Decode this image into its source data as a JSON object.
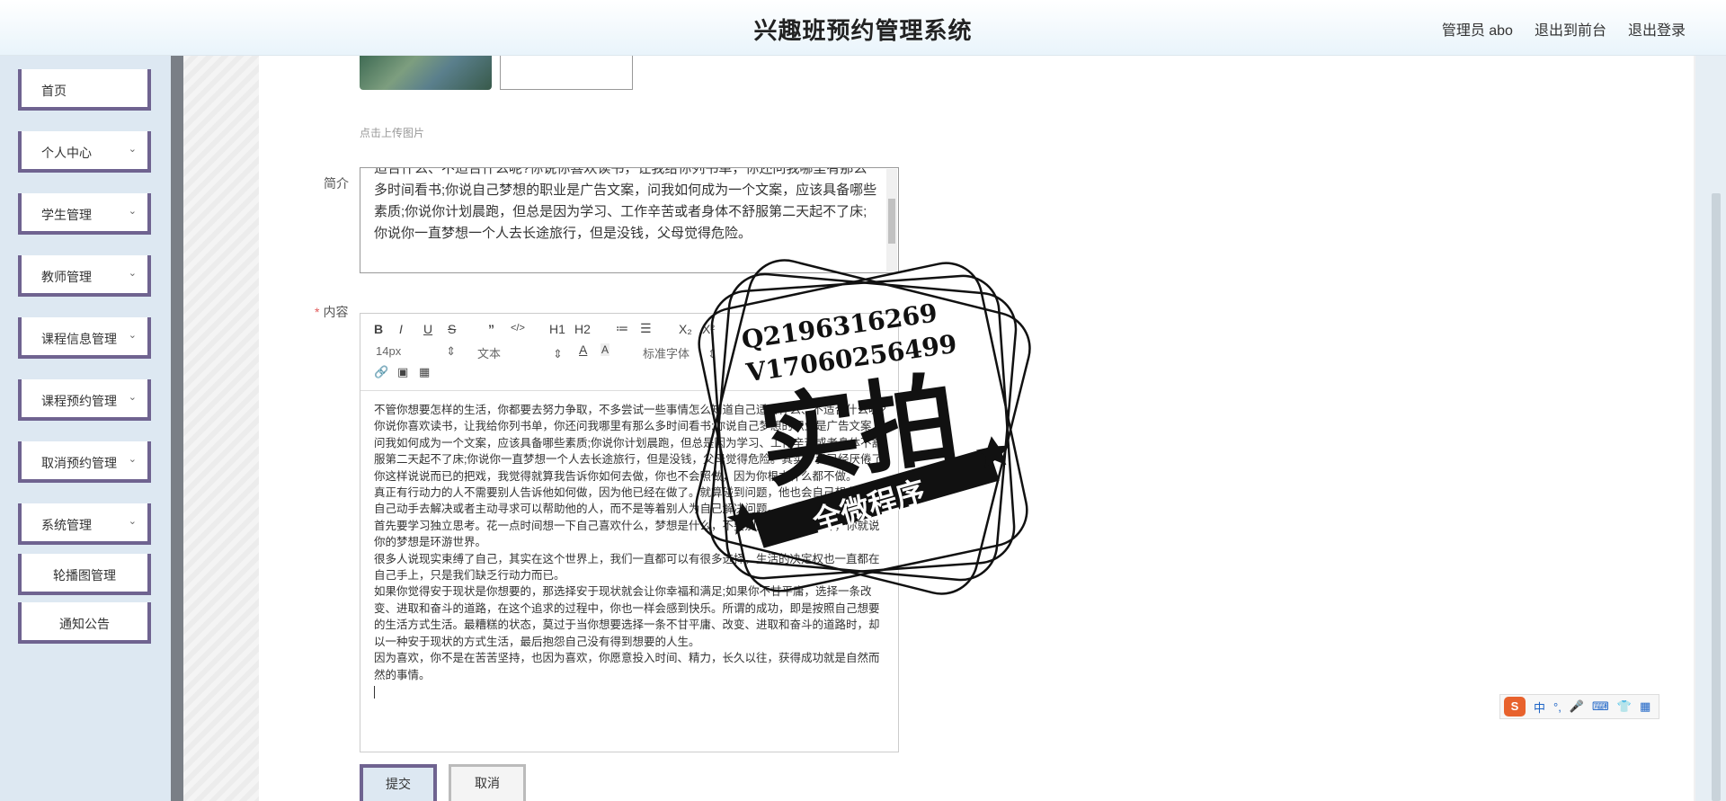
{
  "header": {
    "title": "兴趣班预约管理系统",
    "admin_label": "管理员 abo",
    "front_label": "退出到前台",
    "logout_label": "退出登录"
  },
  "sidebar": {
    "items": [
      {
        "label": "首页",
        "has_arrow": false
      },
      {
        "label": "个人中心",
        "has_arrow": true
      },
      {
        "label": "学生管理",
        "has_arrow": true
      },
      {
        "label": "教师管理",
        "has_arrow": true
      },
      {
        "label": "课程信息管理",
        "has_arrow": true
      },
      {
        "label": "课程预约管理",
        "has_arrow": true
      },
      {
        "label": "取消预约管理",
        "has_arrow": true
      },
      {
        "label": "系统管理",
        "has_arrow": true
      },
      {
        "label": "轮播图管理",
        "has_arrow": false
      },
      {
        "label": "通知公告",
        "has_arrow": false
      }
    ]
  },
  "form": {
    "upload_tip": "点击上传图片",
    "intro_label": "简介",
    "intro_text": "适合什么、不适合什么呢?你说你喜欢读书，让我给你列书单，你还问我哪里有那么多时间看书;你说自己梦想的职业是广告文案，问我如何成为一个文案，应该具备哪些素质;你说你计划晨跑，但总是因为学习、工作辛苦或者身体不舒服第二天起不了床;你说你一直梦想一个人去长途旅行，但是没钱，父母觉得危险。",
    "content_required_mark": "*",
    "content_label": "内容",
    "submit_label": "提交",
    "cancel_label": "取消"
  },
  "editor": {
    "toolbar": {
      "bold": "B",
      "italic": "I",
      "underline": "U",
      "strike": "S",
      "quote": "”",
      "code": "</>",
      "h1": "H1",
      "h2": "H2",
      "ordered_list": "≔",
      "bullet_list": "☰",
      "subscript": "X₂",
      "superscript": "X²",
      "font_size": "14px",
      "text_style": "文本",
      "font_family": "标准字体"
    },
    "paragraphs": [
      "不管你想要怎样的生活，你都要去努力争取，不多尝试一些事情怎么知道自己适合什么、不适合什么呢?",
      "你说你喜欢读书，让我给你列书单，你还问我哪里有那么多时间看书;你说自己梦想的职业是广告文案，问我如何成为一个文案，应该具备哪些素质;你说你计划晨跑，但总是因为学习、工作辛苦或者身体不舒服第二天起不了床;你说你一直梦想一个人去长途旅行，但是没钱，父母觉得危险。其实，我已经厌倦了你这样说说而已的把戏，我觉得就算我告诉你如何去做，你也不会照做，因为你根本什么都不做。",
      "真正有行动力的人不需要别人告诉他如何做，因为他已经在做了。就算碰到问题，他也会自己想办法，自己动手去解决或者主动寻求可以帮助他的人，而不是等着别人为自己解决问题。",
      "首先要学习独立思考。花一点时间想一下自己喜欢什么，梦想是什么，不要别人说想环游世界，你就说你的梦想是环游世界。",
      "很多人说现实束缚了自己，其实在这个世界上，我们一直都可以有很多选择，生活的决定权也一直都在自己手上，只是我们缺乏行动力而已。",
      "如果你觉得安于现状是你想要的，那选择安于现状就会让你幸福和满足;如果你不甘平庸，选择一条改变、进取和奋斗的道路，在这个追求的过程中，你也一样会感到快乐。所谓的成功，即是按照自己想要的生活方式生活。最糟糕的状态，莫过于当你想要选择一条不甘平庸、改变、进取和奋斗的道路时，却以一种安于现状的方式生活，最后抱怨自己没有得到想要的人生。",
      "因为喜欢，你不是在苦苦坚持，也因为喜欢，你愿意投入时间、精力，长久以往，获得成功就是自然而然的事情。"
    ]
  },
  "watermark": {
    "line1": "Q2196316269",
    "line2": "V17060256499",
    "big_text": "实拍",
    "ribbon_text": "全微程序"
  },
  "ime_toolbar": {
    "logo": "S",
    "lang": "中",
    "punct": "°,"
  },
  "colors": {
    "menu_border": "#6f6390",
    "sidebar_bg": "#dde8f2",
    "required": "#e05a5a"
  }
}
